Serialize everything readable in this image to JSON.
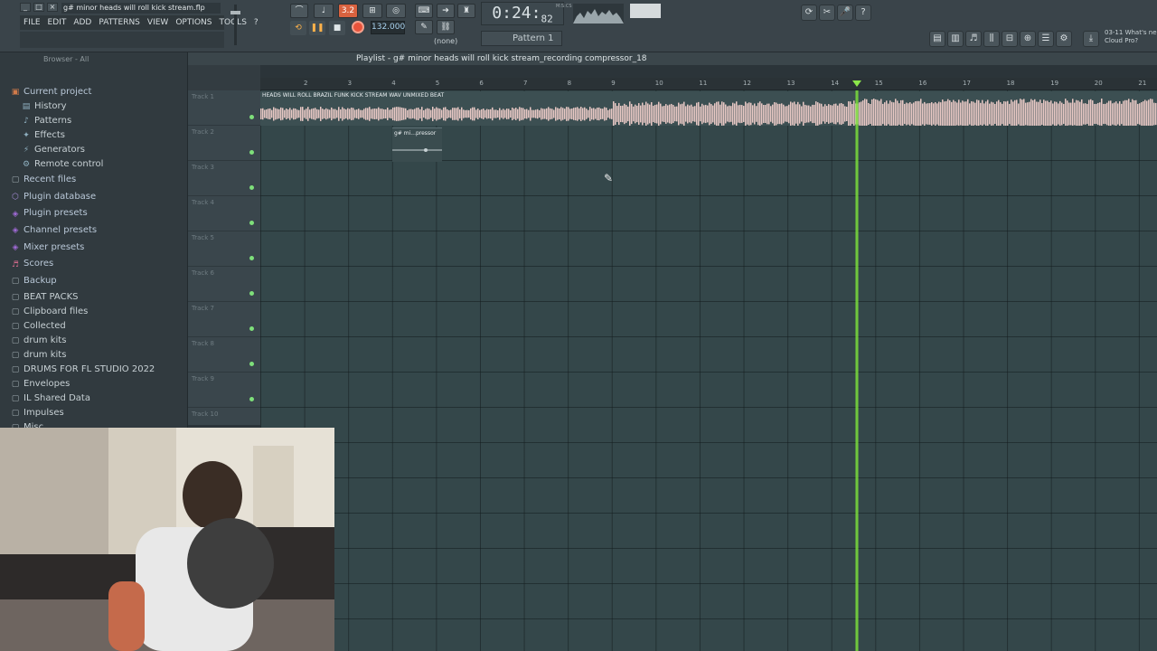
{
  "window": {
    "file_title": "g# minor heads will roll kick stream.flp",
    "controls": [
      "_",
      "□",
      "×"
    ]
  },
  "menu": [
    "FILE",
    "EDIT",
    "ADD",
    "PATTERNS",
    "VIEW",
    "OPTIONS",
    "TOOLS",
    "?"
  ],
  "transport": {
    "mode_label": "3.2",
    "tempo": "132.000",
    "time": "0:24",
    "time_fraction": "82",
    "time_units": "M:S:CS",
    "pattern": "Pattern 1",
    "pattern_mode": "(none)"
  },
  "news": {
    "line1": "03-11  What's ne",
    "line2": "Cloud Pro?"
  },
  "browser": {
    "title": "Browser - All",
    "items": [
      {
        "label": "Current project",
        "icon": "folder-open-icon",
        "level": 0
      },
      {
        "label": "History",
        "icon": "history-icon",
        "level": 1
      },
      {
        "label": "Patterns",
        "icon": "patterns-icon",
        "level": 1
      },
      {
        "label": "Effects",
        "icon": "effects-icon",
        "level": 1
      },
      {
        "label": "Generators",
        "icon": "generators-icon",
        "level": 1
      },
      {
        "label": "Remote control",
        "icon": "remote-icon",
        "level": 1
      },
      {
        "label": "Recent files",
        "icon": "folder-icon",
        "level": 0
      },
      {
        "label": "Plugin database",
        "icon": "plugin-icon",
        "level": 0
      },
      {
        "label": "Plugin presets",
        "icon": "preset-icon",
        "level": 0
      },
      {
        "label": "Channel presets",
        "icon": "preset-icon",
        "level": 0
      },
      {
        "label": "Mixer presets",
        "icon": "preset-icon",
        "level": 0
      },
      {
        "label": "Scores",
        "icon": "score-icon",
        "level": 0
      },
      {
        "label": "Backup",
        "icon": "folder-icon",
        "level": 0
      },
      {
        "label": "BEAT PACKS",
        "icon": "folder-icon",
        "level": 0
      },
      {
        "label": "Clipboard files",
        "icon": "folder-icon",
        "level": 0
      },
      {
        "label": "Collected",
        "icon": "folder-icon",
        "level": 0
      },
      {
        "label": "drum kits",
        "icon": "folder-icon",
        "level": 0
      },
      {
        "label": "drum kits",
        "icon": "folder-icon",
        "level": 0
      },
      {
        "label": "DRUMS FOR FL STUDIO 2022",
        "icon": "folder-icon",
        "level": 0
      },
      {
        "label": "Envelopes",
        "icon": "folder-icon",
        "level": 0
      },
      {
        "label": "IL Shared Data",
        "icon": "folder-icon",
        "level": 0
      },
      {
        "label": "Impulses",
        "icon": "folder-icon",
        "level": 0
      },
      {
        "label": "Misc",
        "icon": "folder-icon",
        "level": 0
      }
    ]
  },
  "playlist": {
    "title": "Playlist - g# minor heads will roll kick stream_recording compressor_18",
    "ruler": [
      "2",
      "3",
      "4",
      "5",
      "6",
      "7",
      "8",
      "9",
      "10",
      "11",
      "12",
      "13",
      "14",
      "15",
      "16",
      "17",
      "18",
      "19",
      "20",
      "21"
    ],
    "tracks": [
      "Track 1",
      "Track 2",
      "Track 3",
      "Track 4",
      "Track 5",
      "Track 6",
      "Track 7",
      "Track 8",
      "Track 9",
      "Track 10"
    ],
    "audio_clip_title": "HEADS WILL ROLL BRAZIL FUNK KICK STREAM WAV UNMIXED BEAT",
    "pattern_clip_title": "g# mi...pressor"
  }
}
